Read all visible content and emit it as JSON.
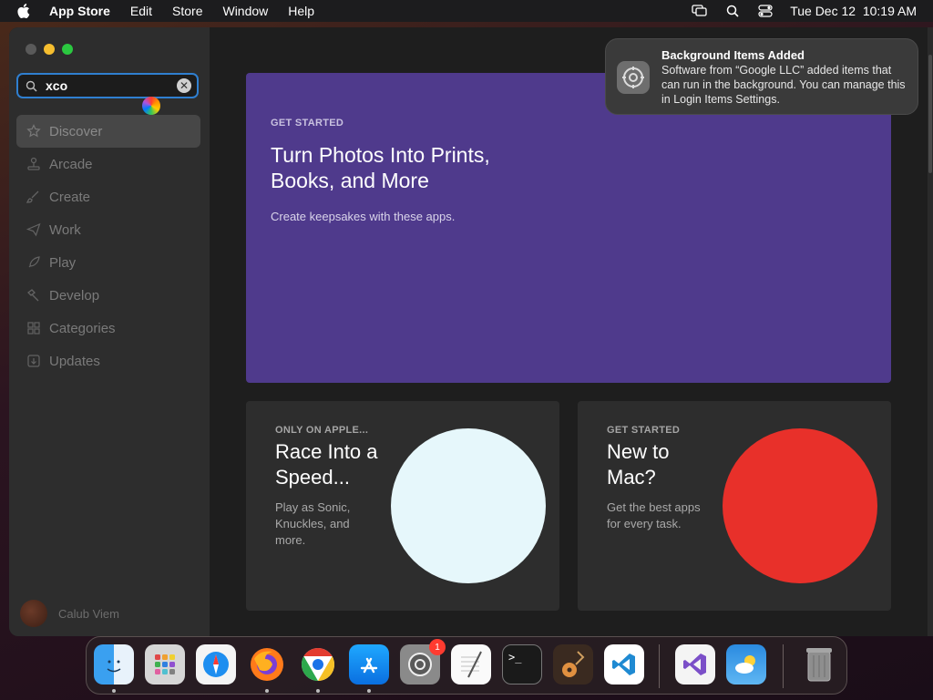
{
  "menubar": {
    "app_name": "App Store",
    "menus": [
      "Edit",
      "Store",
      "Window",
      "Help"
    ],
    "clock": "Tue Dec 12  10:19 AM"
  },
  "sidebar": {
    "search": {
      "value": "xco"
    },
    "items": [
      {
        "label": "Discover",
        "icon": "star-icon",
        "active": true
      },
      {
        "label": "Arcade",
        "icon": "joystick-icon"
      },
      {
        "label": "Create",
        "icon": "brush-icon"
      },
      {
        "label": "Work",
        "icon": "paperplane-icon"
      },
      {
        "label": "Play",
        "icon": "rocket-icon"
      },
      {
        "label": "Develop",
        "icon": "hammer-icon"
      },
      {
        "label": "Categories",
        "icon": "grid-icon"
      },
      {
        "label": "Updates",
        "icon": "download-icon"
      }
    ],
    "user": {
      "name": "Calub Viem"
    }
  },
  "hero": {
    "eyebrow": "GET STARTED",
    "title": "Turn Photos Into Prints, Books, and More",
    "subtitle": "Create keepsakes with these apps.",
    "color": "#4f3a8c"
  },
  "cards": [
    {
      "eyebrow": "ONLY ON APPLE...",
      "title": "Race Into a Speed...",
      "desc": "Play as Sonic, Knuckles, and more.",
      "circle_color": "#e6f7fb"
    },
    {
      "eyebrow": "GET STARTED",
      "title": "New to Mac?",
      "desc": "Get the best apps for every task.",
      "circle_color": "#e8302a"
    }
  ],
  "notification": {
    "title": "Background Items Added",
    "body": "Software from “Google LLC” added items that can run in the background. You can manage this in Login Items Settings.",
    "icon": "gear-icon"
  },
  "dock": {
    "items": [
      {
        "name": "finder",
        "running": true
      },
      {
        "name": "launchpad"
      },
      {
        "name": "safari"
      },
      {
        "name": "firefox",
        "running": true
      },
      {
        "name": "chrome",
        "running": true
      },
      {
        "name": "app-store",
        "running": true
      },
      {
        "name": "system-settings",
        "badge": "1"
      },
      {
        "name": "textedit"
      },
      {
        "name": "terminal"
      },
      {
        "name": "garageband"
      },
      {
        "name": "vscode"
      },
      {
        "name": "visual-studio"
      },
      {
        "name": "weather"
      },
      {
        "name": "trash"
      }
    ]
  }
}
